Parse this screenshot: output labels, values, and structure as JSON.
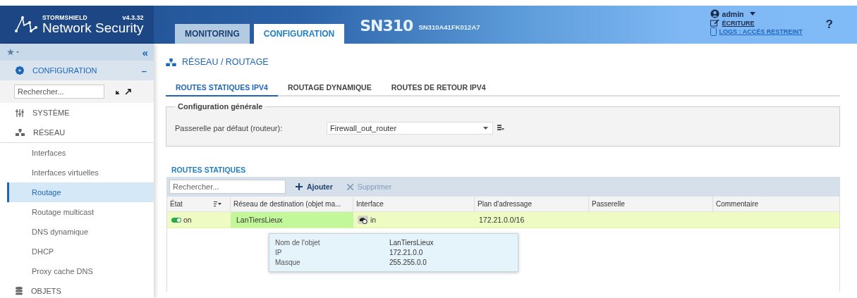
{
  "header": {
    "brand": "STORMSHIELD",
    "product": "Network Security",
    "version": "v4.3.32",
    "tabs": [
      {
        "label": "MONITORING",
        "selected": false
      },
      {
        "label": "CONFIGURATION",
        "selected": true
      }
    ],
    "model": "SN310",
    "serial": "SN310A41FK012A7",
    "user": "admin",
    "access": "ÉCRITURE",
    "logs": "LOGS : ACCÉS RESTREINT",
    "help": "?"
  },
  "sidebar": {
    "collapse": "«",
    "section": {
      "label": "CONFIGURATION",
      "toggle": "–"
    },
    "search": {
      "placeholder": "Rechercher..."
    },
    "groups": [
      {
        "label": "SYSTÈME",
        "expanded": false
      },
      {
        "label": "RÉSEAU",
        "expanded": true,
        "children": [
          {
            "label": "Interfaces",
            "selected": false
          },
          {
            "label": "Interfaces virtuelles",
            "selected": false
          },
          {
            "label": "Routage",
            "selected": true
          },
          {
            "label": "Routage multicast",
            "selected": false
          },
          {
            "label": "DNS dynamique",
            "selected": false
          },
          {
            "label": "DHCP",
            "selected": false
          },
          {
            "label": "Proxy cache DNS",
            "selected": false
          }
        ]
      },
      {
        "label": "OBJETS",
        "expanded": false
      }
    ]
  },
  "main": {
    "breadcrumb": "RÉSEAU / ROUTAGE",
    "tabs": [
      {
        "label": "ROUTES STATIQUES IPV4",
        "selected": true
      },
      {
        "label": "ROUTAGE DYNAMIQUE",
        "selected": false
      },
      {
        "label": "ROUTES DE RETOUR IPV4",
        "selected": false
      }
    ],
    "general": {
      "legend": "Configuration générale",
      "label": "Passerelle par défaut (routeur):",
      "value": "Firewall_out_router"
    },
    "routes": {
      "title": "ROUTES STATIQUES",
      "search": {
        "placeholder": "Rechercher..."
      },
      "actions": [
        {
          "label": "Ajouter",
          "disabled": false
        },
        {
          "label": "Supprimer",
          "disabled": true
        }
      ],
      "columns": [
        "État",
        "Réseau de destination (objet ma...",
        "Interface",
        "Plan d'adressage",
        "Passerelle",
        "Commentaire"
      ],
      "rows": [
        {
          "selected": true,
          "on": true,
          "state": "on",
          "destination": "LanTiersLieux",
          "interface": "in",
          "plan": "172.21.0.0/16"
        }
      ],
      "tooltip": [
        {
          "key": "Nom de l'objet",
          "value": "LanTiersLieux"
        },
        {
          "key": "IP",
          "value": "172.21.0.0"
        },
        {
          "key": "Masque",
          "value": "255.255.0.0"
        }
      ]
    }
  }
}
